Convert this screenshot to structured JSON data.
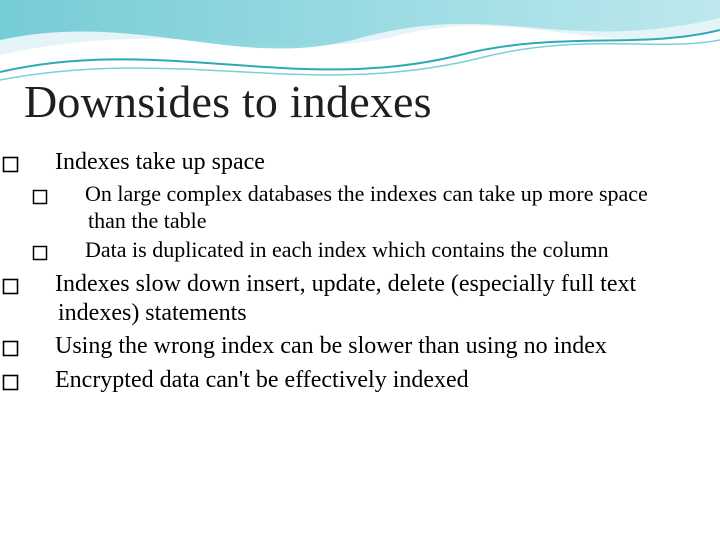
{
  "slide": {
    "title": "Downsides to indexes",
    "bullets": [
      {
        "level": 1,
        "text": "Indexes take up space"
      },
      {
        "level": 2,
        "text": "On large complex databases the indexes can take up more space than the table"
      },
      {
        "level": 2,
        "text": "Data is duplicated in each index which contains the column"
      },
      {
        "level": 1,
        "text": "Indexes slow down insert, update, delete (especially full text indexes) statements"
      },
      {
        "level": 1,
        "text": "Using the wrong index can be slower than using no index"
      },
      {
        "level": 1,
        "text": "Encrypted data can't be effectively indexed"
      }
    ]
  },
  "theme": {
    "wave_color_1": "#3fb8c7",
    "wave_color_2": "#8fd9e4",
    "wave_color_3": "#d7f0f4",
    "title_color": "#1f1f1f"
  }
}
